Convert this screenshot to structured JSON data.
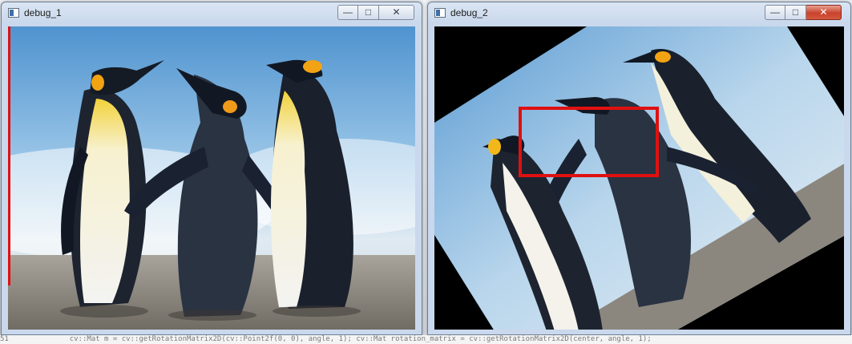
{
  "windows": [
    {
      "title": "debug_1",
      "controls": {
        "minimize": "—",
        "maximize": "□",
        "close": "✕"
      },
      "image": "penguins photo"
    },
    {
      "title": "debug_2",
      "controls": {
        "minimize": "—",
        "maximize": "□",
        "close": "✕"
      },
      "image": "penguins photo rotated",
      "rectangle_color": "#e01010"
    }
  ],
  "code_line": "51              cv::Mat m = cv::getRotationMatrix2D(cv::Point2f(0, 0), angle, 1); cv::Mat rotation_matrix = cv::getRotationMatrix2D(center, angle, 1);",
  "colors": {
    "sky": "#7fb4df",
    "ground": "#8e8a83",
    "highlight": "#e01010"
  }
}
